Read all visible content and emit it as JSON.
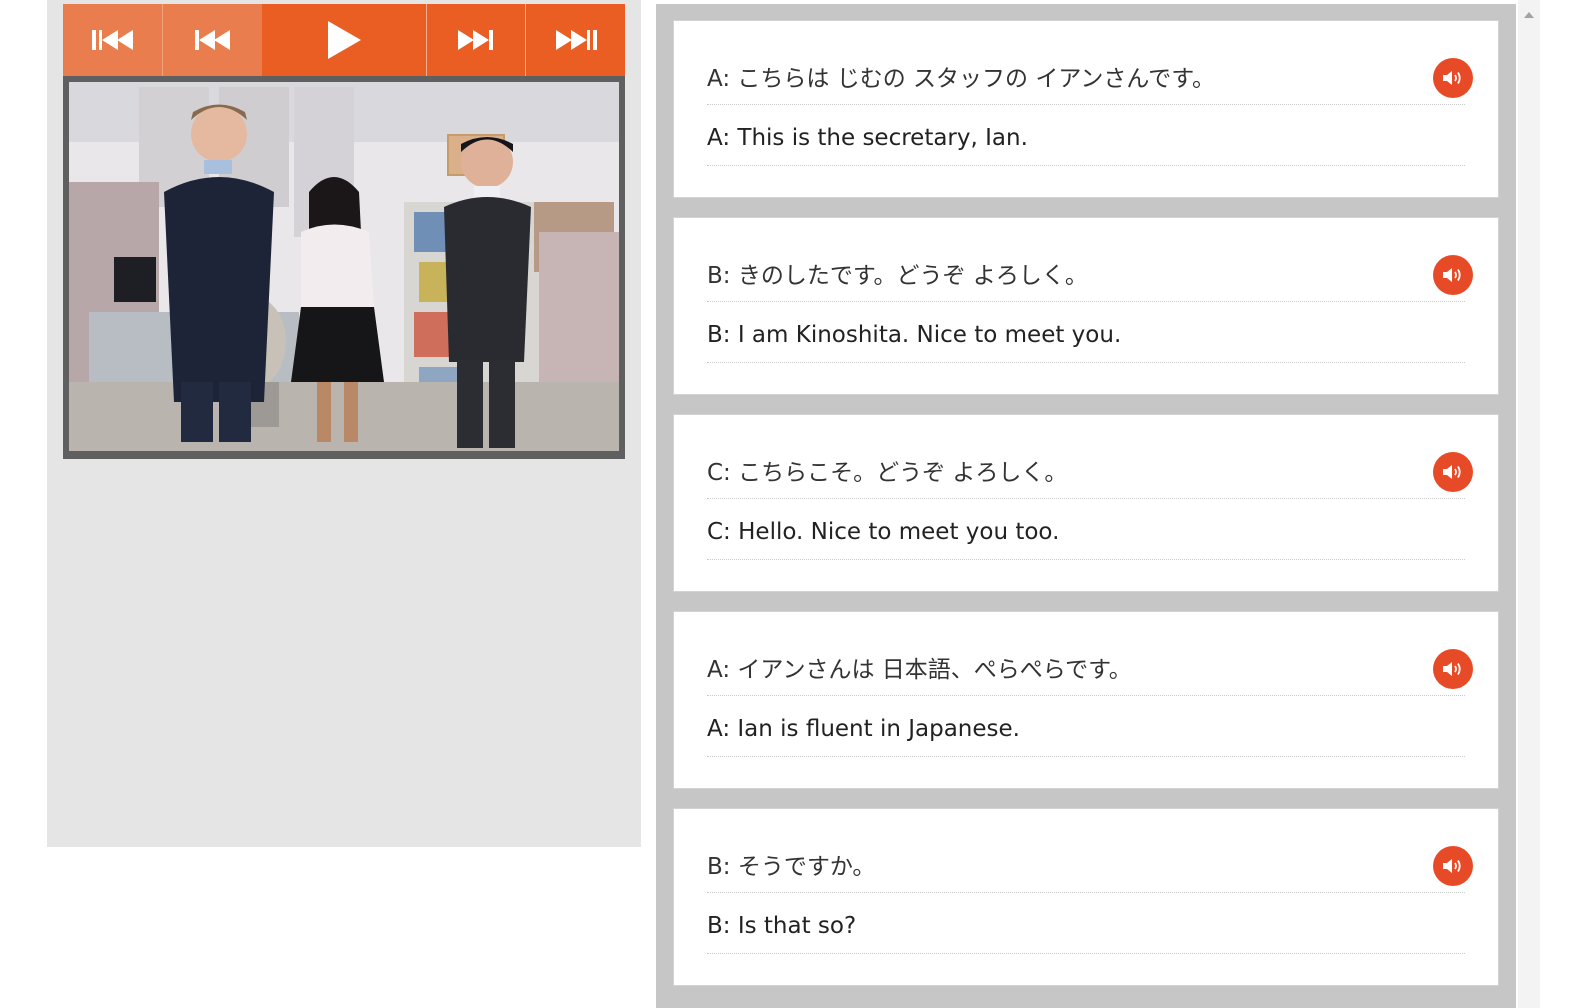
{
  "player": {
    "controls": [
      {
        "icon": "first-track-icon",
        "label": "first"
      },
      {
        "icon": "previous-icon",
        "label": "previous"
      },
      {
        "icon": "play-icon",
        "label": "play"
      },
      {
        "icon": "next-icon",
        "label": "next"
      },
      {
        "icon": "last-track-icon",
        "label": "last"
      }
    ],
    "accent_color": "#ea5d23",
    "inactive_color": "#ea7d4e"
  },
  "dialogue": [
    {
      "jp": "A: こちらは じむの スタッフの イアンさんです。",
      "en": "A: This is the secretary, Ian."
    },
    {
      "jp": "B: きのしたです。どうぞ よろしく。",
      "en": "B: I am Kinoshita. Nice to meet you."
    },
    {
      "jp": "C: こちらこそ。どうぞ よろしく。",
      "en": "C: Hello. Nice to meet you too."
    },
    {
      "jp": "A: イアンさんは 日本語、ぺらぺらです。",
      "en": "A: Ian is fluent in Japanese."
    },
    {
      "jp": "B: そうですか。",
      "en": "B: Is that so?"
    }
  ],
  "audio_icon": "speaker-icon",
  "audio_color": "#e74a26"
}
